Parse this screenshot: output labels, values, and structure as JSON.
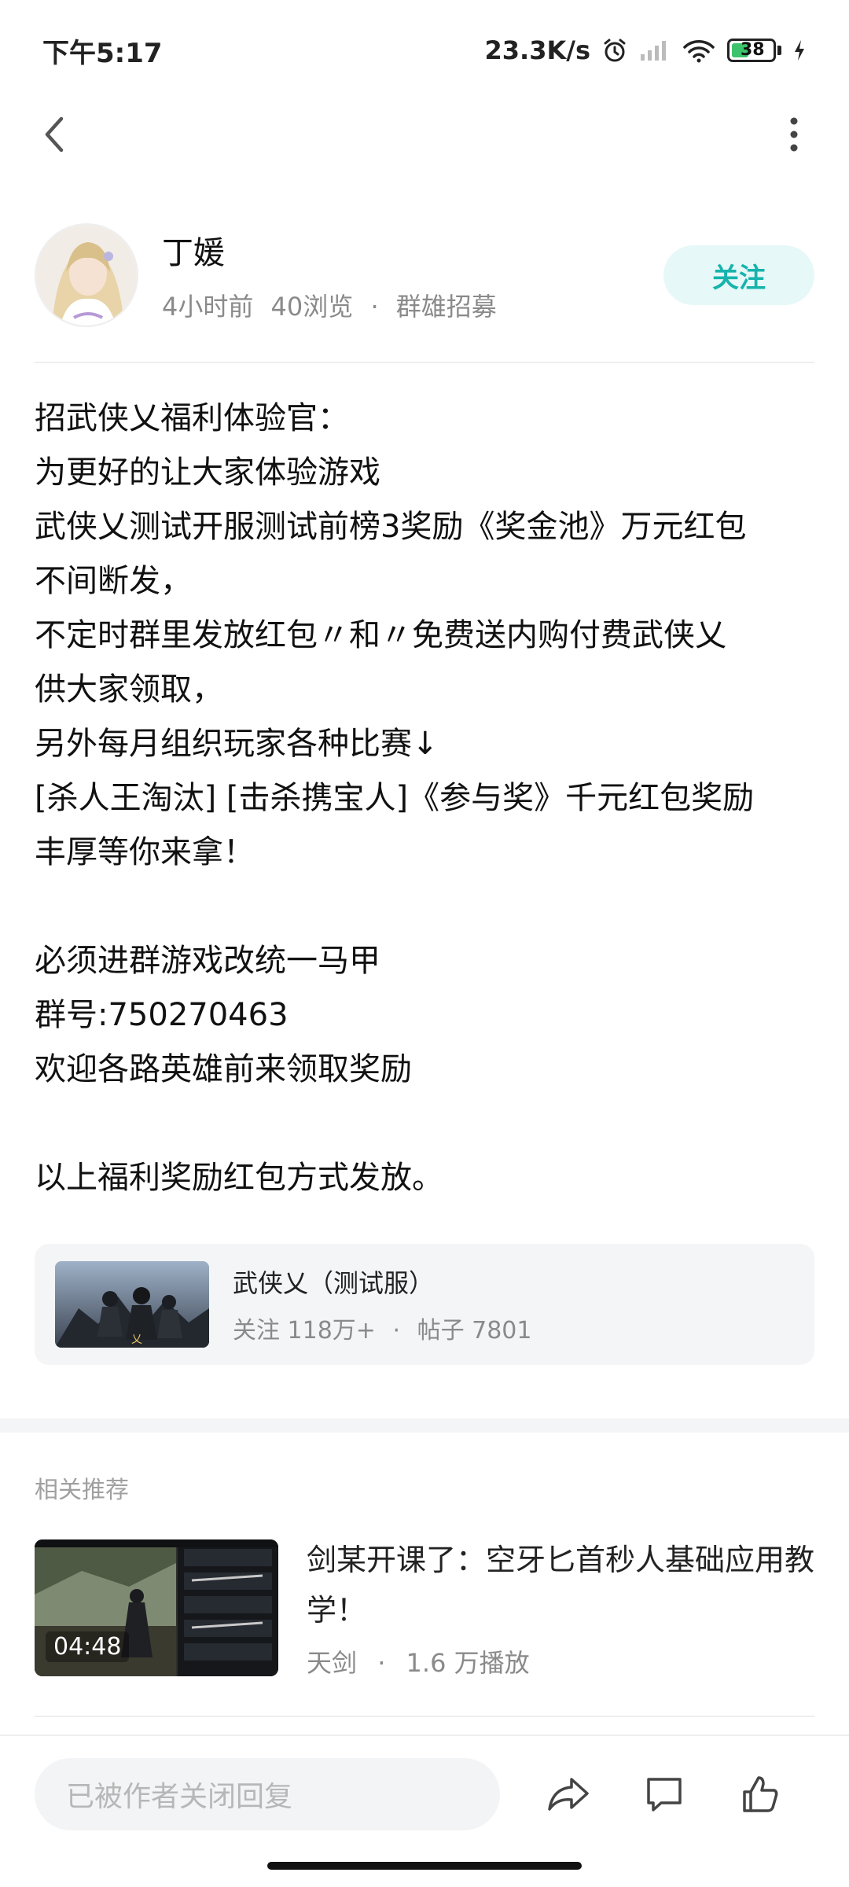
{
  "status_bar": {
    "time": "下午5:17",
    "net_speed": "23.3K/s",
    "battery_level": "38",
    "icons": [
      "alarm-icon",
      "signal-icon",
      "wifi-icon",
      "battery-icon",
      "charging-icon"
    ]
  },
  "nav": {
    "back_icon": "back-chevron-icon",
    "more_icon": "more-vertical-icon"
  },
  "author": {
    "name": "丁媛",
    "time": "4小时前",
    "views": "40浏览",
    "separator": "·",
    "group": "群雄招募",
    "follow_label": "关注"
  },
  "post": {
    "lines": [
      "招武侠乂福利体验官：",
      "为更好的让大家体验游戏",
      "武侠乂测试开服测试前榜3奖励《奖金池》万元红包",
      "不间断发，",
      "不定时群里发放红包〃和〃免费送内购付费武侠乂",
      "供大家领取，",
      "另外每月组织玩家各种比赛↓",
      "[杀人王淘汰] [击杀携宝人]《参与奖》千元红包奖励",
      "丰厚等你来拿！",
      "",
      "必须进群游戏改统一马甲",
      "群号:750270463",
      "欢迎各路英雄前来领取奖励",
      "",
      "以上福利奖励红包方式发放。"
    ]
  },
  "game_card": {
    "name": "武侠乂（测试服）",
    "follows": "关注 118万+",
    "separator": "·",
    "posts": "帖子 7801"
  },
  "related": {
    "title": "相关推荐",
    "items": [
      {
        "title": "剑某开课了：空牙匕首秒人基础应用教学！",
        "duration": "04:48",
        "author": "天剑",
        "separator": "·",
        "plays": "1.6 万播放"
      }
    ]
  },
  "bottom_bar": {
    "reply_placeholder": "已被作者关闭回复",
    "icons": [
      "share-icon",
      "comment-icon",
      "like-icon"
    ]
  },
  "colors": {
    "accent": "#17b3ad",
    "follow_bg": "#e6f8f7",
    "card_bg": "#f4f5f7",
    "muted_text": "#8a8a8a"
  }
}
